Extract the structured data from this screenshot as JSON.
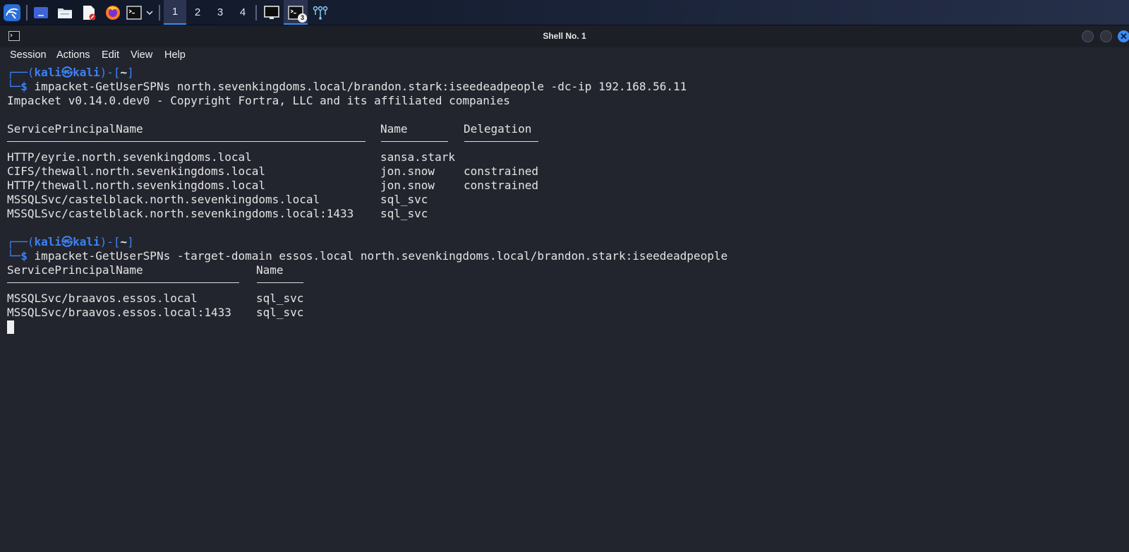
{
  "taskbar": {
    "workspaces": [
      "1",
      "2",
      "3",
      "4"
    ],
    "active_workspace": "1",
    "terminal_badge": "3",
    "icons": [
      "kali-menu-icon",
      "desktop-icon",
      "file-manager-icon",
      "text-editor-icon",
      "firefox-icon",
      "terminal-icon",
      "chevron-down-icon",
      "window-icon",
      "terminal-app-icon",
      "network-icon"
    ]
  },
  "window": {
    "title": "Shell No. 1"
  },
  "menu": {
    "items": [
      "Session",
      "Actions",
      "Edit",
      "View",
      "Help"
    ]
  },
  "terminal": {
    "prompt1": {
      "box_top": "┌──(",
      "user": "kali㉿kali",
      "mid": ")-[",
      "dir": "~",
      "end": "]",
      "box_bottom": "└─$",
      "command": "impacket-GetUserSPNs north.sevenkingdoms.local/brandon.stark:iseedeadpeople -dc-ip 192.168.56.11"
    },
    "banner": "Impacket v0.14.0.dev0 - Copyright Fortra, LLC and its affiliated companies",
    "table1": {
      "headers": [
        "ServicePrincipalName",
        "Name",
        "Delegation"
      ],
      "rows": [
        [
          "HTTP/eyrie.north.sevenkingdoms.local",
          "sansa.stark",
          ""
        ],
        [
          "CIFS/thewall.north.sevenkingdoms.local",
          "jon.snow",
          "constrained"
        ],
        [
          "HTTP/thewall.north.sevenkingdoms.local",
          "jon.snow",
          "constrained"
        ],
        [
          "MSSQLSvc/castelblack.north.sevenkingdoms.local",
          "sql_svc",
          ""
        ],
        [
          "MSSQLSvc/castelblack.north.sevenkingdoms.local:1433",
          "sql_svc",
          ""
        ]
      ]
    },
    "prompt2": {
      "box_top": "┌──(",
      "user": "kali㉿kali",
      "mid": ")-[",
      "dir": "~",
      "end": "]",
      "box_bottom": "└─$",
      "command": "impacket-GetUserSPNs -target-domain essos.local north.sevenkingdoms.local/brandon.stark:iseedeadpeople"
    },
    "table2": {
      "headers": [
        "ServicePrincipalName",
        "Name"
      ],
      "rows": [
        [
          "MSSQLSvc/braavos.essos.local",
          "sql_svc"
        ],
        [
          "MSSQLSvc/braavos.essos.local:1433",
          "sql_svc"
        ]
      ]
    }
  },
  "colors": {
    "background": "#23252e",
    "prompt": "#3b82f6",
    "text": "#e4e4e4",
    "accent": "#3a8cf0"
  }
}
